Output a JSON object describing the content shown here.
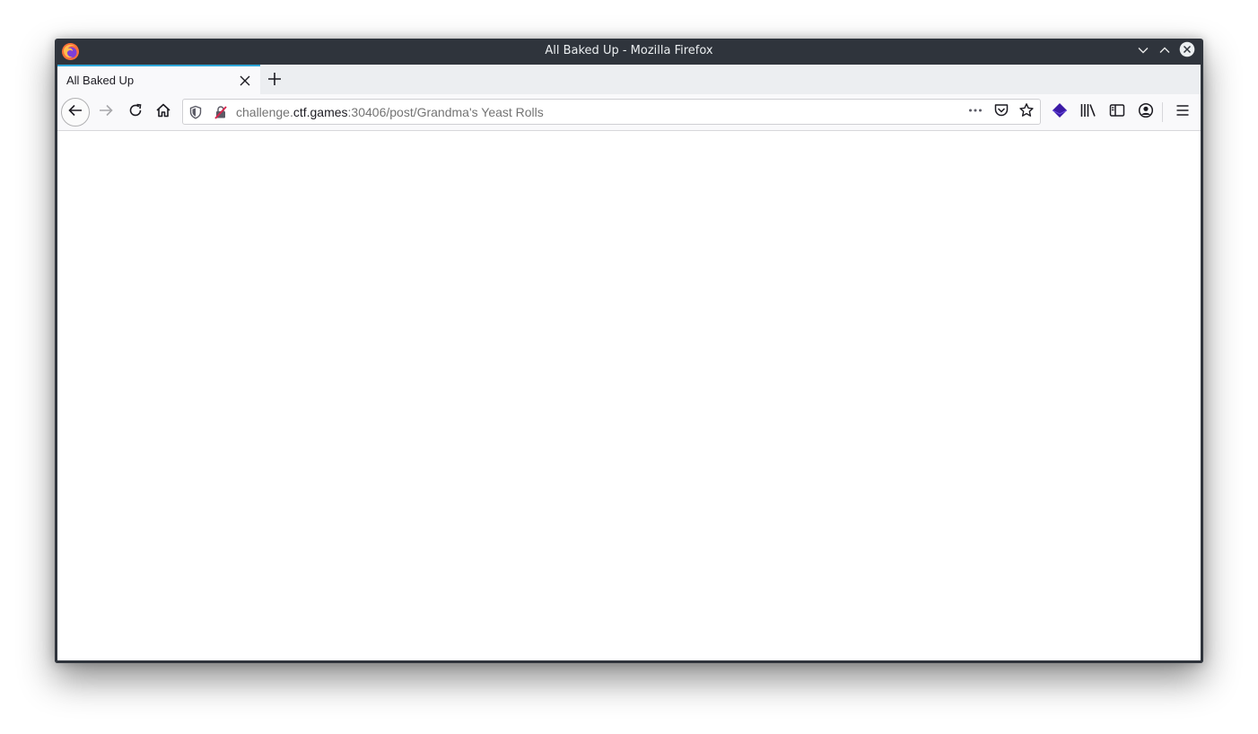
{
  "window": {
    "title": "All Baked Up - Mozilla Firefox"
  },
  "tabs": [
    {
      "label": "All Baked Up",
      "active": true
    }
  ],
  "urlbar": {
    "url_prefix": "challenge.",
    "url_domain": "ctf.games",
    "url_suffix": ":30406/post/Grandma's Yeast Rolls"
  },
  "icons": {
    "app": "firefox-icon",
    "minimize": "chevron-down-icon",
    "maximize": "chevron-up-icon",
    "close": "close-icon",
    "tab_close": "close-icon",
    "new_tab": "plus-icon",
    "back": "arrow-left-icon",
    "forward": "arrow-right-icon",
    "reload": "reload-icon",
    "home": "home-icon",
    "shield": "tracking-protection-shield-icon",
    "insecure": "insecure-lock-icon",
    "page_actions": "more-horizontal-icon",
    "pocket": "pocket-icon",
    "bookmark": "star-icon",
    "extension": "extension-icon",
    "library": "library-icon",
    "sidebar": "sidebar-icon",
    "account": "account-icon",
    "menu": "hamburger-menu-icon"
  },
  "colors": {
    "titlebar": "#2f343c",
    "tab_accent": "#2fa7d8",
    "extension": "#3b1aa6",
    "insecure": "#d7264e"
  }
}
